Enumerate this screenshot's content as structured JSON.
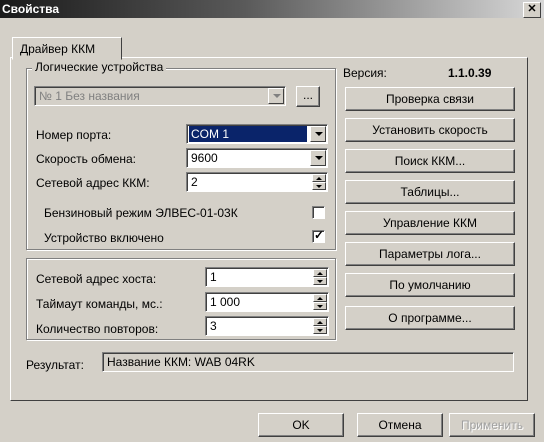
{
  "window": {
    "title": "Свойства",
    "close_glyph": "✕"
  },
  "tab": {
    "label": "Драйвер ККМ"
  },
  "logical_devices": {
    "legend": "Логические устройства",
    "device_value": "№ 1 Без названия",
    "browse_label": "..."
  },
  "port": {
    "label": "Номер порта:",
    "value": "COM 1"
  },
  "speed": {
    "label": "Скорость обмена:",
    "value": "9600"
  },
  "net_address": {
    "label": "Сетевой адрес ККМ:",
    "value": "2"
  },
  "gasoline_mode": {
    "label": "Бензиновый режим ЭЛВЕС-01-03К",
    "checked": false
  },
  "device_enabled": {
    "label": "Устройство включено",
    "checked": true
  },
  "host": {
    "address_label": "Сетевой адрес хоста:",
    "address_value": "1",
    "timeout_label": "Таймаут команды, мс.:",
    "timeout_value": "1 000",
    "retries_label": "Количество повторов:",
    "retries_value": "3"
  },
  "version": {
    "label": "Версия:",
    "value": "1.1.0.39"
  },
  "buttons": {
    "check_connection": "Проверка связи",
    "set_speed": "Установить скорость",
    "search_kkm": "Поиск ККМ...",
    "tables": "Таблицы...",
    "control_kkm": "Управление ККМ",
    "log_params": "Параметры лога...",
    "defaults": "По умолчанию",
    "about": "О программе..."
  },
  "result": {
    "label": "Результат:",
    "value": "Название ККМ: WAB 04RK"
  },
  "footer": {
    "ok": "OK",
    "cancel": "Отмена",
    "apply": "Применить"
  }
}
